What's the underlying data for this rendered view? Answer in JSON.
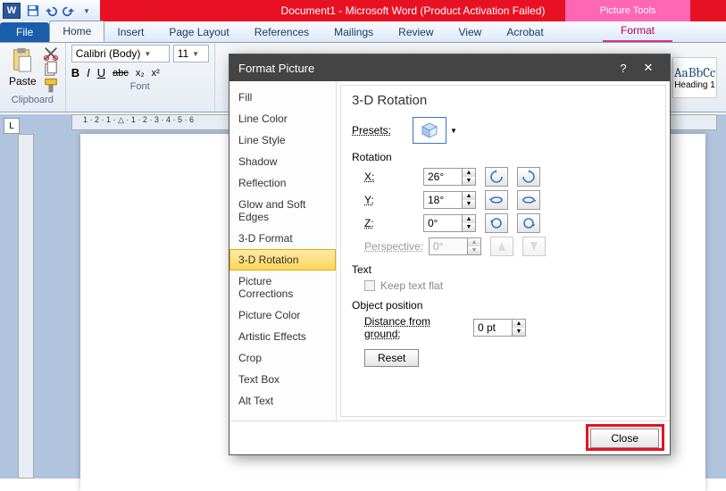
{
  "window": {
    "title": "Document1 - Microsoft Word (Product Activation Failed)",
    "context_tab_group": "Picture Tools"
  },
  "tabs": {
    "file": "File",
    "home": "Home",
    "insert": "Insert",
    "pagelayout": "Page Layout",
    "references": "References",
    "mailings": "Mailings",
    "review": "Review",
    "view": "View",
    "acrobat": "Acrobat",
    "format": "Format"
  },
  "ribbon": {
    "clipboard": {
      "paste": "Paste",
      "group": "Clipboard"
    },
    "font": {
      "name": "Calibri (Body)",
      "size": "11",
      "group": "Font",
      "bold": "B",
      "italic": "I",
      "underline": "U",
      "strike": "abc",
      "sub": "x₂",
      "sup": "x²"
    },
    "style": {
      "preview": "AaBbCc",
      "name": "Heading 1"
    }
  },
  "ruler": {
    "marks": "1 · 2 · 1 · △ · 1 · 2 · 3 · 4 · 5 · 6"
  },
  "dialog": {
    "title": "Format Picture",
    "help": "?",
    "close_x": "✕",
    "nav": {
      "fill": "Fill",
      "linecolor": "Line Color",
      "linestyle": "Line Style",
      "shadow": "Shadow",
      "reflection": "Reflection",
      "glow": "Glow and Soft Edges",
      "format3d": "3-D Format",
      "rotation3d": "3-D Rotation",
      "corrections": "Picture Corrections",
      "color": "Picture Color",
      "artistic": "Artistic Effects",
      "crop": "Crop",
      "textbox": "Text Box",
      "alttext": "Alt Text"
    },
    "panel": {
      "heading": "3-D Rotation",
      "presets_label": "Presets:",
      "rotation_label": "Rotation",
      "x_label": "X:",
      "x_val": "26°",
      "y_label": "Y:",
      "y_val": "18°",
      "z_label": "Z:",
      "z_val": "0°",
      "persp_label": "Perspective:",
      "persp_val": "0°",
      "text_label": "Text",
      "keepflat": "Keep text flat",
      "objpos_label": "Object position",
      "dist_label": "Distance from ground:",
      "dist_val": "0 pt",
      "reset": "Reset"
    },
    "close": "Close"
  },
  "qat": {
    "save": "💾",
    "undo": "↶",
    "redo": "↷"
  }
}
